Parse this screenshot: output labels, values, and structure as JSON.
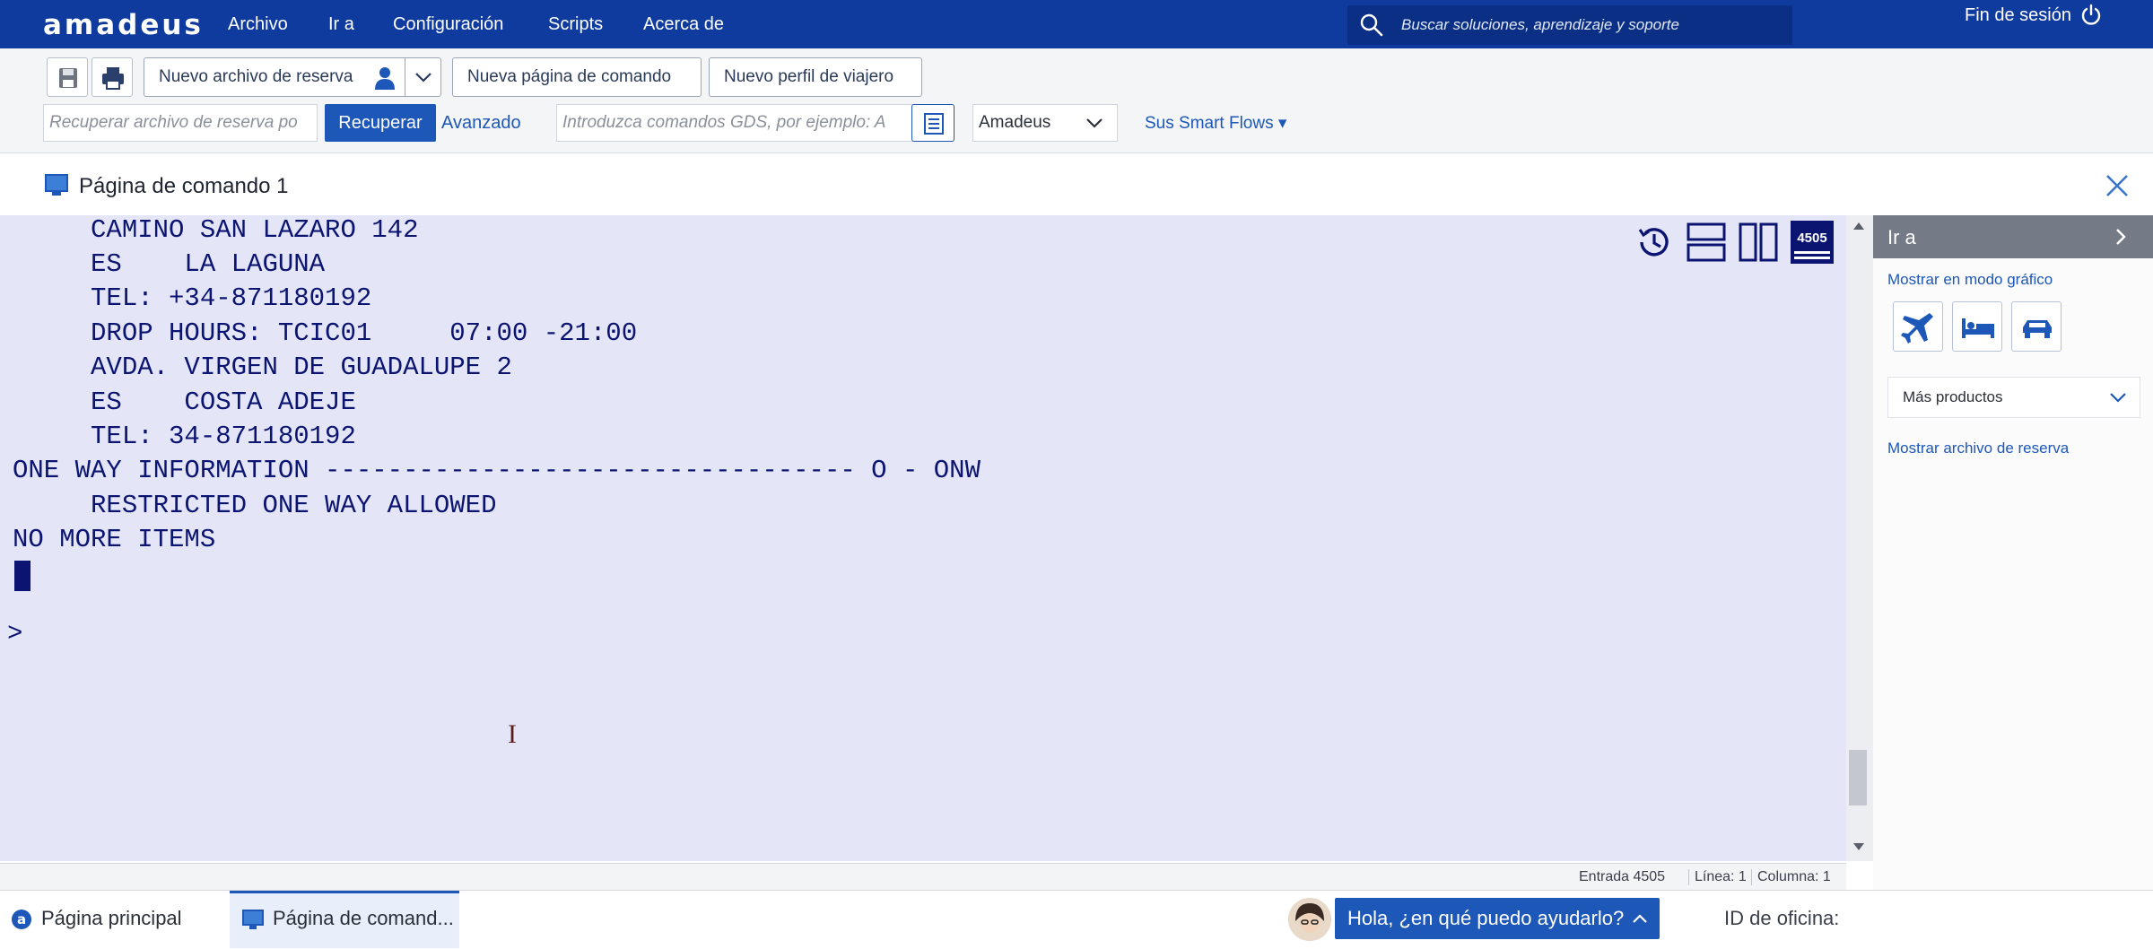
{
  "brand": {
    "logo": "amadeus"
  },
  "nav": {
    "items": [
      "Archivo",
      "Ir a",
      "Configuración",
      "Scripts",
      "Acerca de"
    ],
    "search_placeholder": "Buscar soluciones, aprendizaje y soporte",
    "logout_label": "Fin de sesión"
  },
  "toolbar": {
    "new_reservation": "Nuevo archivo de reserva",
    "new_command_page": "Nueva página de comando",
    "new_traveler_profile": "Nuevo perfil de viajero",
    "retrieve_placeholder": "Recuperar archivo de reserva po",
    "retrieve_button": "Recuperar",
    "advanced_link": "Avanzado",
    "gds_placeholder": "Introduzca comandos GDS, por ejemplo: A",
    "gds_select": "Amadeus",
    "smart_flows": "Sus Smart Flows ▾"
  },
  "page": {
    "title": "Página de comando 1"
  },
  "terminal": {
    "badge": "4505",
    "lines": [
      "     CAMINO SAN LAZARO 142",
      "     ES    LA LAGUNA",
      "     TEL: +34-871180192",
      "     DROP HOURS: TCIC01     07:00 -21:00",
      "     AVDA. VIRGEN DE GUADALUPE 2",
      "     ES    COSTA ADEJE",
      "     TEL: 34-871180192",
      "ONE WAY INFORMATION ---------------------------------- O - ONW",
      "     RESTRICTED ONE WAY ALLOWED",
      "NO MORE ITEMS"
    ],
    "prompt": ">",
    "ibeam": "I"
  },
  "status": {
    "entry": "Entrada 4505",
    "line": "Línea: 1",
    "column": "Columna: 1"
  },
  "right_panel": {
    "title": "Ir a",
    "graphic_mode": "Mostrar en modo gráfico",
    "more_products": "Más productos",
    "show_reservation": "Mostrar archivo de reserva"
  },
  "bottom": {
    "tab_home": "Página principal",
    "tab_command": "Página de comand...",
    "chat": "Hola, ¿en qué puedo ayudarlo?",
    "office_label": "ID de oficina:"
  },
  "colors": {
    "topbar": "#0f3a9e",
    "terminal_bg": "#e4e6f7",
    "terminal_text": "#0b1470",
    "accent": "#1d57b8"
  }
}
